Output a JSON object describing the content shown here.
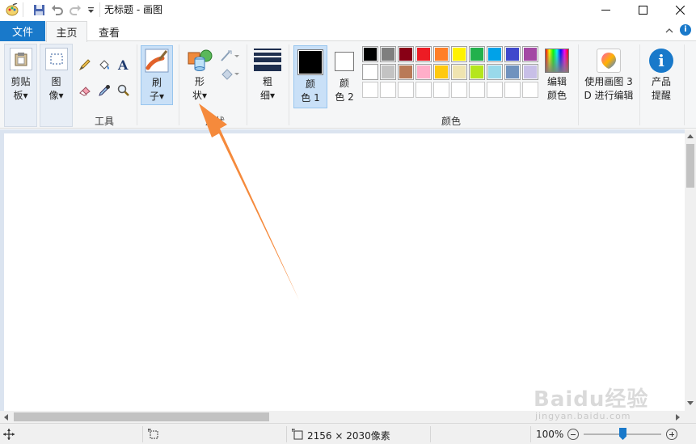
{
  "titlebar": {
    "title": "无标题 - 画图",
    "minimize": "minimize",
    "maximize": "maximize",
    "close": "close"
  },
  "tabs": {
    "file": "文件",
    "home": "主页",
    "view": "查看"
  },
  "ribbon": {
    "clipboard": {
      "line1": "剪贴",
      "line2": "板▾"
    },
    "image": {
      "line1": "图",
      "line2": "像▾"
    },
    "tools_label": "工具",
    "brush": {
      "line1": "刷",
      "line2": "子▾"
    },
    "shapes": {
      "line1": "形",
      "line2": "状▾"
    },
    "shapes_group_label": "形状",
    "size": {
      "line1": "粗",
      "line2": "细▾"
    },
    "color1": {
      "line1": "颜",
      "line2": "色 1"
    },
    "color2": {
      "line1": "颜",
      "line2": "色 2"
    },
    "colors_label": "颜色",
    "edit_colors": {
      "line1": "编辑",
      "line2": "颜色"
    },
    "paint3d": {
      "line1": "使用画图 3",
      "line2": "D 进行编辑"
    },
    "product_alert": {
      "line1": "产品",
      "line2": "提醒"
    }
  },
  "palette": {
    "row1": [
      "#000000",
      "#7f7f7f",
      "#880015",
      "#ed1c24",
      "#ff7f27",
      "#fff200",
      "#22b14c",
      "#00a2e8",
      "#3f48cc",
      "#a349a4"
    ],
    "row2": [
      "#ffffff",
      "#c3c3c3",
      "#b97a57",
      "#ffaec9",
      "#ffc90e",
      "#efe4b0",
      "#b5e61d",
      "#99d9ea",
      "#7092be",
      "#c8bfe7"
    ],
    "row3_empty_count": 10,
    "color1": "#000000",
    "color2": "#ffffff"
  },
  "status": {
    "image_size": "2156 × 2030像素",
    "zoom": "100%"
  },
  "watermark": {
    "brand": "Baidu经验",
    "url": "jingyan.baidu.com"
  },
  "annotation": {
    "arrow_color": "#f58a3c"
  }
}
